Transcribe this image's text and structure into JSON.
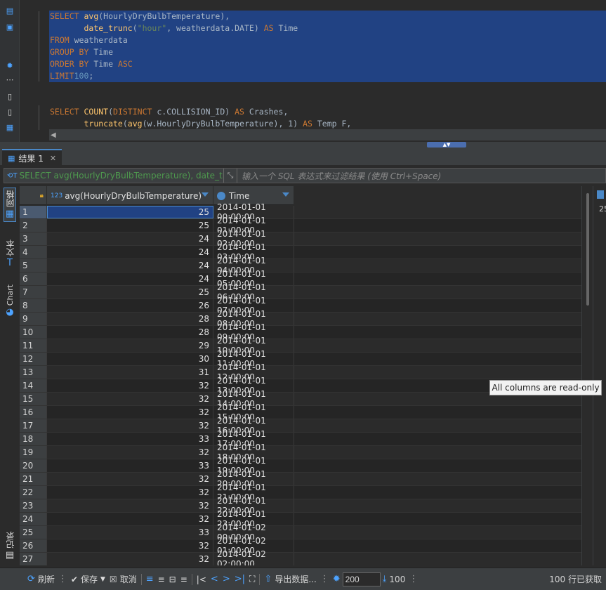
{
  "editor": {
    "lines": [
      {
        "selected": true,
        "parts": [
          [
            "kw",
            "SELECT "
          ],
          [
            "fn",
            "avg"
          ],
          [
            "",
            "(HourlyDryBulbTemperature),"
          ]
        ]
      },
      {
        "selected": true,
        "parts": [
          [
            "",
            "       "
          ],
          [
            "fn",
            "date_trunc"
          ],
          [
            "",
            "("
          ],
          [
            "str",
            "\"hour\""
          ],
          [
            "",
            ", weatherdata.DATE) "
          ],
          [
            "kw",
            "AS"
          ],
          [
            "",
            " Time"
          ]
        ]
      },
      {
        "selected": true,
        "parts": [
          [
            "kw",
            "FROM"
          ],
          [
            "",
            " weatherdata"
          ]
        ]
      },
      {
        "selected": true,
        "parts": [
          [
            "kw",
            "GROUP BY"
          ],
          [
            "",
            " Time"
          ]
        ]
      },
      {
        "selected": true,
        "parts": [
          [
            "kw",
            "ORDER BY"
          ],
          [
            "",
            " Time "
          ],
          [
            "kw",
            "ASC"
          ]
        ]
      },
      {
        "selected": true,
        "parts": [
          [
            "kw",
            "LIMIT"
          ],
          [
            " ",
            ""
          ],
          [
            "num",
            "100"
          ],
          [
            "",
            ";"
          ]
        ]
      },
      {
        "selected": false,
        "parts": [
          [
            "",
            ""
          ]
        ]
      },
      {
        "selected": false,
        "parts": [
          [
            "",
            ""
          ]
        ]
      },
      {
        "selected": false,
        "parts": [
          [
            "kw",
            "SELECT "
          ],
          [
            "fn",
            "COUNT"
          ],
          [
            "",
            "("
          ],
          [
            "kw",
            "DISTINCT"
          ],
          [
            "",
            " c.COLLISION_ID) "
          ],
          [
            "kw",
            "AS"
          ],
          [
            "",
            " Crashes,"
          ]
        ]
      },
      {
        "selected": false,
        "parts": [
          [
            "",
            "       "
          ],
          [
            "fn",
            "truncate"
          ],
          [
            "",
            "("
          ],
          [
            "fn",
            "avg"
          ],
          [
            "",
            "(w.HourlyDryBulbTemperature), 1) "
          ],
          [
            "kw",
            "AS"
          ],
          [
            "",
            " Temp F,"
          ]
        ]
      }
    ]
  },
  "results_tab": {
    "label": "结果 1"
  },
  "filter": {
    "query_text": "SELECT avg(HourlyDryBulbTemperature), date_tru",
    "placeholder": "输入一个 SQL 表达式来过滤结果 (使用 Ctrl+Space)"
  },
  "side_tabs": {
    "grid": "网格",
    "text": "文本",
    "chart": "Chart",
    "record": "记录"
  },
  "grid": {
    "columns": [
      {
        "type_label": "123",
        "label": "avg(HourlyDryBulbTemperature)"
      },
      {
        "label": "Time"
      }
    ],
    "rows": [
      {
        "n": "1",
        "v": "25",
        "t": "2014-01-01 00:00:00"
      },
      {
        "n": "2",
        "v": "25",
        "t": "2014-01-01 01:00:00"
      },
      {
        "n": "3",
        "v": "24",
        "t": "2014-01-01 02:00:00"
      },
      {
        "n": "4",
        "v": "24",
        "t": "2014-01-01 03:00:00"
      },
      {
        "n": "5",
        "v": "24",
        "t": "2014-01-01 04:00:00"
      },
      {
        "n": "6",
        "v": "24",
        "t": "2014-01-01 05:00:00"
      },
      {
        "n": "7",
        "v": "25",
        "t": "2014-01-01 06:00:00"
      },
      {
        "n": "8",
        "v": "26",
        "t": "2014-01-01 07:00:00"
      },
      {
        "n": "9",
        "v": "28",
        "t": "2014-01-01 08:00:00"
      },
      {
        "n": "10",
        "v": "28",
        "t": "2014-01-01 09:00:00"
      },
      {
        "n": "11",
        "v": "29",
        "t": "2014-01-01 10:00:00"
      },
      {
        "n": "12",
        "v": "30",
        "t": "2014-01-01 11:00:00"
      },
      {
        "n": "13",
        "v": "31",
        "t": "2014-01-01 12:00:00"
      },
      {
        "n": "14",
        "v": "32",
        "t": "2014-01-01 13:00:00"
      },
      {
        "n": "15",
        "v": "32",
        "t": "2014-01-01 14:00:00"
      },
      {
        "n": "16",
        "v": "32",
        "t": "2014-01-01 15:00:00"
      },
      {
        "n": "17",
        "v": "32",
        "t": "2014-01-01 16:00:00"
      },
      {
        "n": "18",
        "v": "33",
        "t": "2014-01-01 17:00:00"
      },
      {
        "n": "19",
        "v": "32",
        "t": "2014-01-01 18:00:00"
      },
      {
        "n": "20",
        "v": "33",
        "t": "2014-01-01 19:00:00"
      },
      {
        "n": "21",
        "v": "32",
        "t": "2014-01-01 20:00:00"
      },
      {
        "n": "22",
        "v": "32",
        "t": "2014-01-01 21:00:00"
      },
      {
        "n": "23",
        "v": "32",
        "t": "2014-01-01 22:00:00"
      },
      {
        "n": "24",
        "v": "32",
        "t": "2014-01-01 23:00:00"
      },
      {
        "n": "25",
        "v": "33",
        "t": "2014-01-02 00:00:00"
      },
      {
        "n": "26",
        "v": "32",
        "t": "2014-01-02 01:00:00"
      },
      {
        "n": "27",
        "v": "32",
        "t": "2014-01-02 02:00:00"
      }
    ]
  },
  "right_strip": {
    "text": "25"
  },
  "tooltip": {
    "text": "All columns are read-only"
  },
  "toolbar": {
    "refresh": "刷新",
    "save": "保存",
    "cancel": "取消",
    "export": "导出数据...",
    "fetch_size": "200",
    "count_value": "100",
    "row_status": "100 行已获取"
  },
  "colors": {
    "accent": "#4a88c7",
    "selection": "#214283",
    "background": "#2b2b2b"
  }
}
